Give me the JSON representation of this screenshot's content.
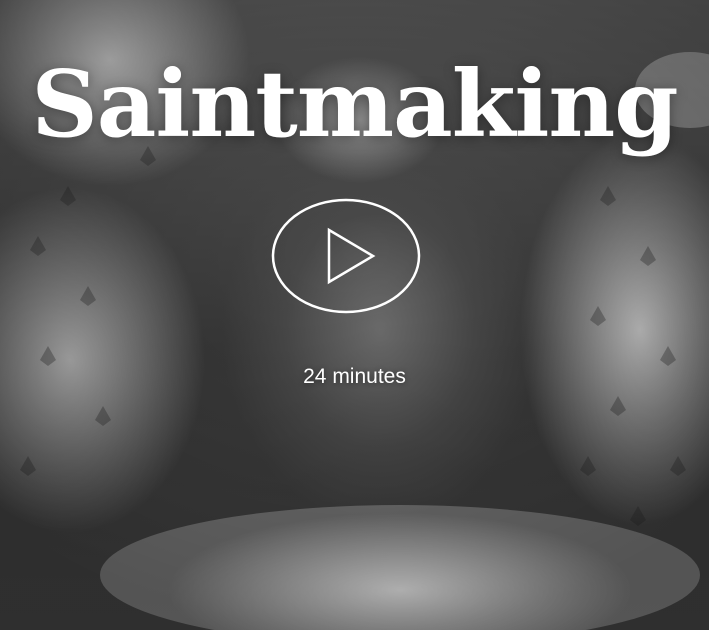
{
  "video": {
    "title": "Saintmaking",
    "duration": "24 minutes",
    "play_icon": "play-icon"
  },
  "colors": {
    "text": "#ffffff",
    "play_outline": "#ffffff"
  }
}
